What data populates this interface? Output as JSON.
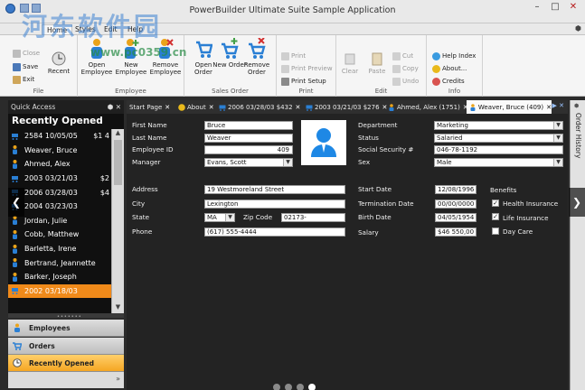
{
  "window": {
    "title": "PowerBuilder Ultimate Suite Sample Application",
    "min": "–",
    "max": "□",
    "close": "✕"
  },
  "ribbon": {
    "tabs": [
      "Home",
      "Styles",
      "Edit",
      "Help"
    ],
    "pin": "⬢",
    "groups": {
      "file": {
        "label": "File",
        "close": "Close",
        "save": "Save",
        "exit": "Exit",
        "recent": "Recent"
      },
      "employee": {
        "label": "Employee",
        "open": "Open Employee",
        "new": "New Employee",
        "remove": "Remove Employee"
      },
      "sales_order": {
        "label": "Sales Order",
        "open": "Open Order",
        "new": "New Order",
        "remove": "Remove Order"
      },
      "print": {
        "label": "Print",
        "print": "Print",
        "preview": "Print Preview",
        "setup": "Print Setup"
      },
      "edit": {
        "label": "Edit",
        "clear": "Clear",
        "paste": "Paste",
        "cut": "Cut",
        "copy": "Copy",
        "undo": "Undo"
      },
      "info": {
        "label": "Info",
        "help_index": "Help Index",
        "about": "About...",
        "credits": "Credits"
      }
    }
  },
  "quick_access": {
    "header": "Quick Access",
    "controls": "⬢ ✕",
    "title": "Recently Opened",
    "items": [
      {
        "icon": "cart",
        "text": "2584 10/05/05",
        "amount": "$1 4"
      },
      {
        "icon": "person",
        "text": "Weaver, Bruce",
        "amount": ""
      },
      {
        "icon": "person",
        "text": "Ahmed, Alex",
        "amount": ""
      },
      {
        "icon": "cart",
        "text": "2003 03/21/03",
        "amount": "$2"
      },
      {
        "icon": "cart",
        "text": "2006 03/28/03",
        "amount": "$4"
      },
      {
        "icon": "cart",
        "text": "2004 03/23/03",
        "amount": ""
      },
      {
        "icon": "person",
        "text": "Jordan, Julie",
        "amount": ""
      },
      {
        "icon": "person",
        "text": "Cobb, Matthew",
        "amount": ""
      },
      {
        "icon": "person",
        "text": "Barletta, Irene",
        "amount": ""
      },
      {
        "icon": "person",
        "text": "Bertrand, Jeannette",
        "amount": ""
      },
      {
        "icon": "person",
        "text": "Barker, Joseph",
        "amount": ""
      },
      {
        "icon": "cart",
        "text": "2002 03/18/03",
        "amount": "",
        "selected": true
      }
    ],
    "scroll_up": "▲",
    "scroll_down": "▼",
    "splitter": "•••••••",
    "nav": [
      "Employees",
      "Orders",
      "Recently Opened"
    ],
    "footer_arrow": "»"
  },
  "doc_tabs": [
    {
      "icon": "",
      "label": "Start Page"
    },
    {
      "icon": "info",
      "label": "About"
    },
    {
      "icon": "cart",
      "label": "2006 03/28/03 $432"
    },
    {
      "icon": "cart",
      "label": "2003 03/21/03 $276"
    },
    {
      "icon": "person",
      "label": "Ahmed, Alex (1751)"
    },
    {
      "icon": "person",
      "label": "Weaver, Bruce (409)",
      "active": true
    }
  ],
  "tab_close": "✕",
  "tab_nav": "▶ ✕",
  "form": {
    "labels": {
      "first_name": "First Name",
      "last_name": "Last Name",
      "employee_id": "Employee ID",
      "manager": "Manager",
      "department": "Department",
      "status": "Status",
      "ssn": "Social Security #",
      "sex": "Sex",
      "address": "Address",
      "city": "City",
      "state": "State",
      "zip": "Zip Code",
      "phone": "Phone",
      "start_date": "Start Date",
      "termination_date": "Termination Date",
      "birth_date": "Birth Date",
      "salary": "Salary",
      "benefits": "Benefits"
    },
    "values": {
      "first_name": "Bruce",
      "last_name": "Weaver",
      "employee_id": "409",
      "manager": "Evans, Scott",
      "department": "Marketing",
      "status": "Salaried",
      "ssn": "046-78-1192",
      "sex": "Male",
      "address": "19 Westmoreland Street",
      "city": "Lexington",
      "state": "MA",
      "zip": "02173-",
      "phone": "(617) 555-4444",
      "start_date": "12/08/1996",
      "termination_date": "00/00/0000",
      "birth_date": "04/05/1954",
      "salary": "$46 550,00"
    },
    "benefits": [
      {
        "label": "Health Insurance",
        "checked": true
      },
      {
        "label": "Life Insurance",
        "checked": true
      },
      {
        "label": "Day Care",
        "checked": false
      }
    ],
    "checkmark": "✓",
    "dropdown_arrow": "▼"
  },
  "order_history": {
    "label": "Order History",
    "pin": "⬢"
  },
  "carousel": {
    "prev": "❮",
    "next": "❯",
    "dots": 4,
    "active_dot": 3
  },
  "watermark": {
    "text": "河东软件园",
    "url": "www.pc0359.cn"
  },
  "colors": {
    "accent": "#f08a1a",
    "cart": "#2a7fd4",
    "person": "#e9a31b",
    "remove": "#d32f2f",
    "add": "#43a047"
  }
}
